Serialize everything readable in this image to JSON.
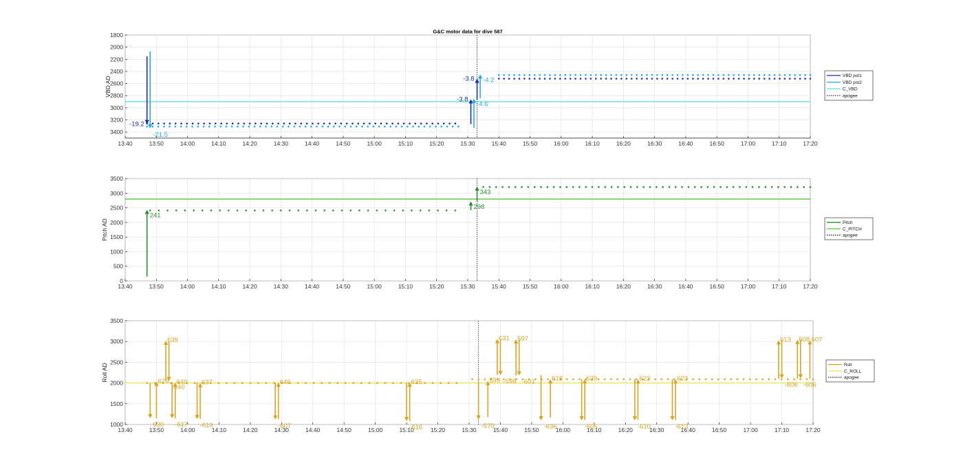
{
  "figure_title": "G&C motor data for dive 587",
  "time_ticks": [
    "13:40",
    "13:50",
    "14:00",
    "14:10",
    "14:20",
    "14:30",
    "14:40",
    "14:50",
    "15:00",
    "15:10",
    "15:20",
    "15:30",
    "15:40",
    "15:50",
    "16:00",
    "16:10",
    "16:20",
    "16:30",
    "16:40",
    "16:50",
    "17:00",
    "17:10",
    "17:20"
  ],
  "colors": {
    "vbd_pot1": "#1f2f9e",
    "vbd_pot2": "#2aa9e8",
    "c_vbd": "#5fe0e8",
    "pitch": "#2e8b32",
    "c_pitch": "#58c23a",
    "roll": "#d4a628",
    "c_roll": "#f2e25a",
    "apogee": "#333333"
  },
  "chart_data": [
    {
      "type": "scatter",
      "ylabel": "VBD AD",
      "ylim": [
        1800,
        3500
      ],
      "yticks": [
        1800,
        2000,
        2200,
        2400,
        2600,
        2800,
        3000,
        3200,
        3400
      ],
      "y_reversed": true,
      "xlim": [
        "13:40",
        "17:20"
      ],
      "grid": true,
      "legend_position": "right",
      "legend": [
        {
          "label": "VBD pot1",
          "style": "solid",
          "color_key": "vbd_pot1"
        },
        {
          "label": "VBD pot2",
          "style": "solid",
          "color_key": "vbd_pot2"
        },
        {
          "label": "C_VBD",
          "style": "solid",
          "color_key": "c_vbd"
        },
        {
          "label": "apogee",
          "style": "dotted",
          "color_key": "apogee"
        }
      ],
      "apogee": "15:33",
      "reference_line": {
        "color_key": "c_vbd",
        "value": 2900
      },
      "series": [
        {
          "color_key": "vbd_pot1",
          "y": 3260,
          "start": "13:47",
          "end": "15:26",
          "n": 55
        },
        {
          "color_key": "vbd_pot2",
          "y": 3310,
          "start": "13:47",
          "end": "15:27",
          "n": 56
        },
        {
          "color_key": "vbd_pot1",
          "y": 2520,
          "start": "15:40",
          "end": "17:20",
          "n": 62
        },
        {
          "color_key": "vbd_pot2",
          "y": 2460,
          "start": "15:40",
          "end": "17:20",
          "n": 62
        }
      ],
      "moves": [
        {
          "t": "13:47",
          "from": 2150,
          "to": 3270,
          "color_key": "vbd_pot1",
          "label": "-19.2",
          "label_side": "left"
        },
        {
          "t": "13:48",
          "from": 2070,
          "to": 3340,
          "color_key": "vbd_pot2",
          "label": "-21.5",
          "label_side": "right-below"
        },
        {
          "t": "15:31",
          "from": 3270,
          "to": 2860,
          "color_key": "vbd_pot1",
          "label": "-3.8",
          "label_side": "left"
        },
        {
          "t": "15:32",
          "from": 3330,
          "to": 2850,
          "color_key": "vbd_pot2",
          "label": "-4.6",
          "label_side": "right-below"
        },
        {
          "t": "15:33",
          "from": 2870,
          "to": 2520,
          "color_key": "vbd_pot1",
          "label": "-3.8",
          "label_side": "left"
        },
        {
          "t": "15:34",
          "from": 2840,
          "to": 2450,
          "color_key": "vbd_pot2",
          "label": "-4.2",
          "label_side": "right-below"
        }
      ]
    },
    {
      "type": "scatter",
      "ylabel": "Pitch AD",
      "ylim": [
        0,
        3500
      ],
      "yticks": [
        0,
        500,
        1000,
        1500,
        2000,
        2500,
        3000,
        3500
      ],
      "y_reversed": false,
      "xlim": [
        "13:40",
        "17:20"
      ],
      "grid": true,
      "legend_position": "right",
      "legend": [
        {
          "label": "Pitch",
          "style": "solid",
          "color_key": "pitch"
        },
        {
          "label": "C_PITCH",
          "style": "solid",
          "color_key": "c_pitch"
        },
        {
          "label": "apogee",
          "style": "dotted",
          "color_key": "apogee"
        }
      ],
      "apogee": "15:33",
      "reference_line": {
        "color_key": "c_pitch",
        "value": 2800
      },
      "series": [
        {
          "color_key": "pitch",
          "y": 2410,
          "start": "13:48",
          "end": "15:26",
          "n": 36
        },
        {
          "color_key": "pitch",
          "y": 3210,
          "start": "15:35",
          "end": "17:20",
          "n": 52
        }
      ],
      "moves": [
        {
          "t": "13:47",
          "from": 150,
          "to": 2430,
          "color_key": "pitch",
          "label": "241",
          "label_side": "right-below"
        },
        {
          "t": "15:31",
          "from": 2420,
          "to": 2720,
          "color_key": "pitch",
          "label": "298",
          "label_side": "right-below"
        },
        {
          "t": "15:33",
          "from": 2730,
          "to": 3230,
          "color_key": "pitch",
          "label": "343",
          "label_side": "right-below"
        }
      ]
    },
    {
      "type": "scatter",
      "ylabel": "Roll AD",
      "ylim": [
        1000,
        3500
      ],
      "yticks": [
        1000,
        1500,
        2000,
        2500,
        3000,
        3500
      ],
      "y_reversed": false,
      "xlim": [
        "13:40",
        "17:20"
      ],
      "grid": true,
      "legend_position": "right",
      "legend": [
        {
          "label": "Roll",
          "style": "solid",
          "color_key": "roll"
        },
        {
          "label": "C_ROLL",
          "style": "solid",
          "color_key": "c_roll"
        },
        {
          "label": "apogee",
          "style": "dotted",
          "color_key": "apogee"
        }
      ],
      "apogee": "15:33",
      "reference_line": {
        "color_key": "c_roll",
        "value": 2000
      },
      "series": [
        {
          "color_key": "roll",
          "y": 2000,
          "start": "13:47",
          "end": "15:26",
          "n": 40
        },
        {
          "color_key": "roll",
          "y": 2090,
          "start": "15:31",
          "end": "17:20",
          "n": 55
        }
      ],
      "moves": [
        {
          "t": "13:48",
          "from": 2000,
          "to": 1150,
          "color_key": "roll",
          "label": "630",
          "label_side": "right-below"
        },
        {
          "t": "13:50",
          "from": 1150,
          "to": 2030,
          "color_key": "roll",
          "label": "629",
          "label_side": "right-above"
        },
        {
          "t": "13:53",
          "from": 2050,
          "to": 3020,
          "color_key": "roll",
          "label": "639",
          "label_side": "right-above"
        },
        {
          "t": "13:54",
          "from": 3000,
          "to": 2050,
          "color_key": "roll",
          "label": "-640",
          "label_side": "right-below"
        },
        {
          "t": "13:55",
          "from": 2020,
          "to": 1150,
          "color_key": "roll",
          "label": "-617",
          "label_side": "right-below"
        },
        {
          "t": "13:56",
          "from": 1150,
          "to": 2010,
          "color_key": "roll",
          "label": "640",
          "label_side": "right-above"
        },
        {
          "t": "14:03",
          "from": 2010,
          "to": 1130,
          "color_key": "roll",
          "label": "-619",
          "label_side": "right-below"
        },
        {
          "t": "14:04",
          "from": 1130,
          "to": 2000,
          "color_key": "roll",
          "label": "637",
          "label_side": "right-above"
        },
        {
          "t": "14:28",
          "from": 2000,
          "to": 1120,
          "color_key": "roll",
          "label": "-607",
          "label_side": "right-below"
        },
        {
          "t": "14:29",
          "from": 1130,
          "to": 2010,
          "color_key": "roll",
          "label": "646",
          "label_side": "right-above"
        },
        {
          "t": "15:10",
          "from": 2010,
          "to": 1080,
          "color_key": "roll",
          "label": "-616",
          "label_side": "right-below"
        },
        {
          "t": "15:11",
          "from": 1080,
          "to": 2010,
          "color_key": "roll",
          "label": "635",
          "label_side": "right-above"
        },
        {
          "t": "15:33",
          "from": 2020,
          "to": 1120,
          "color_key": "roll",
          "label": "-570",
          "label_side": "right-below"
        },
        {
          "t": "15:36",
          "from": 1180,
          "to": 2050,
          "color_key": "roll",
          "label": "599",
          "label_side": "right-above"
        },
        {
          "t": "15:39",
          "from": 2200,
          "to": 3060,
          "color_key": "roll",
          "label": "631",
          "label_side": "right-above"
        },
        {
          "t": "15:40",
          "from": 3050,
          "to": 2190,
          "color_key": "roll",
          "label": "-598",
          "label_side": "right-below"
        },
        {
          "t": "15:45",
          "from": 2180,
          "to": 3050,
          "color_key": "roll",
          "label": "597",
          "label_side": "right-above"
        },
        {
          "t": "15:46",
          "from": 3050,
          "to": 2180,
          "color_key": "roll",
          "label": "-601",
          "label_side": "right-below"
        },
        {
          "t": "15:53",
          "from": 2190,
          "to": 1100,
          "color_key": "roll",
          "label": "-636",
          "label_side": "right-below"
        },
        {
          "t": "15:56",
          "from": 1170,
          "to": 2090,
          "color_key": "roll",
          "label": "618",
          "label_side": "right-above"
        },
        {
          "t": "16:06",
          "from": 2090,
          "to": 1100,
          "color_key": "roll",
          "label": "-605",
          "label_side": "right-below"
        },
        {
          "t": "16:07",
          "from": 1110,
          "to": 2090,
          "color_key": "roll",
          "label": "629",
          "label_side": "right-above"
        },
        {
          "t": "16:23",
          "from": 2090,
          "to": 1100,
          "color_key": "roll",
          "label": "-610",
          "label_side": "right-below"
        },
        {
          "t": "16:24",
          "from": 1110,
          "to": 2090,
          "color_key": "roll",
          "label": "623",
          "label_side": "right-above"
        },
        {
          "t": "16:35",
          "from": 2090,
          "to": 1100,
          "color_key": "roll",
          "label": "-613",
          "label_side": "right-below"
        },
        {
          "t": "16:36",
          "from": 1110,
          "to": 2090,
          "color_key": "roll",
          "label": "623",
          "label_side": "right-above"
        },
        {
          "t": "17:09",
          "from": 2100,
          "to": 3030,
          "color_key": "roll",
          "label": "613",
          "label_side": "right-above"
        },
        {
          "t": "17:10",
          "from": 3030,
          "to": 2110,
          "color_key": "roll",
          "label": "-606",
          "label_side": "right-below"
        },
        {
          "t": "17:15",
          "from": 2100,
          "to": 3040,
          "color_key": "roll",
          "label": "608",
          "label_side": "right-above"
        },
        {
          "t": "17:16",
          "from": 3040,
          "to": 2110,
          "color_key": "roll",
          "label": "-606",
          "label_side": "right-below"
        },
        {
          "t": "17:19",
          "from": 2100,
          "to": 3030,
          "color_key": "roll",
          "label": "607",
          "label_side": "right-above"
        }
      ]
    }
  ]
}
